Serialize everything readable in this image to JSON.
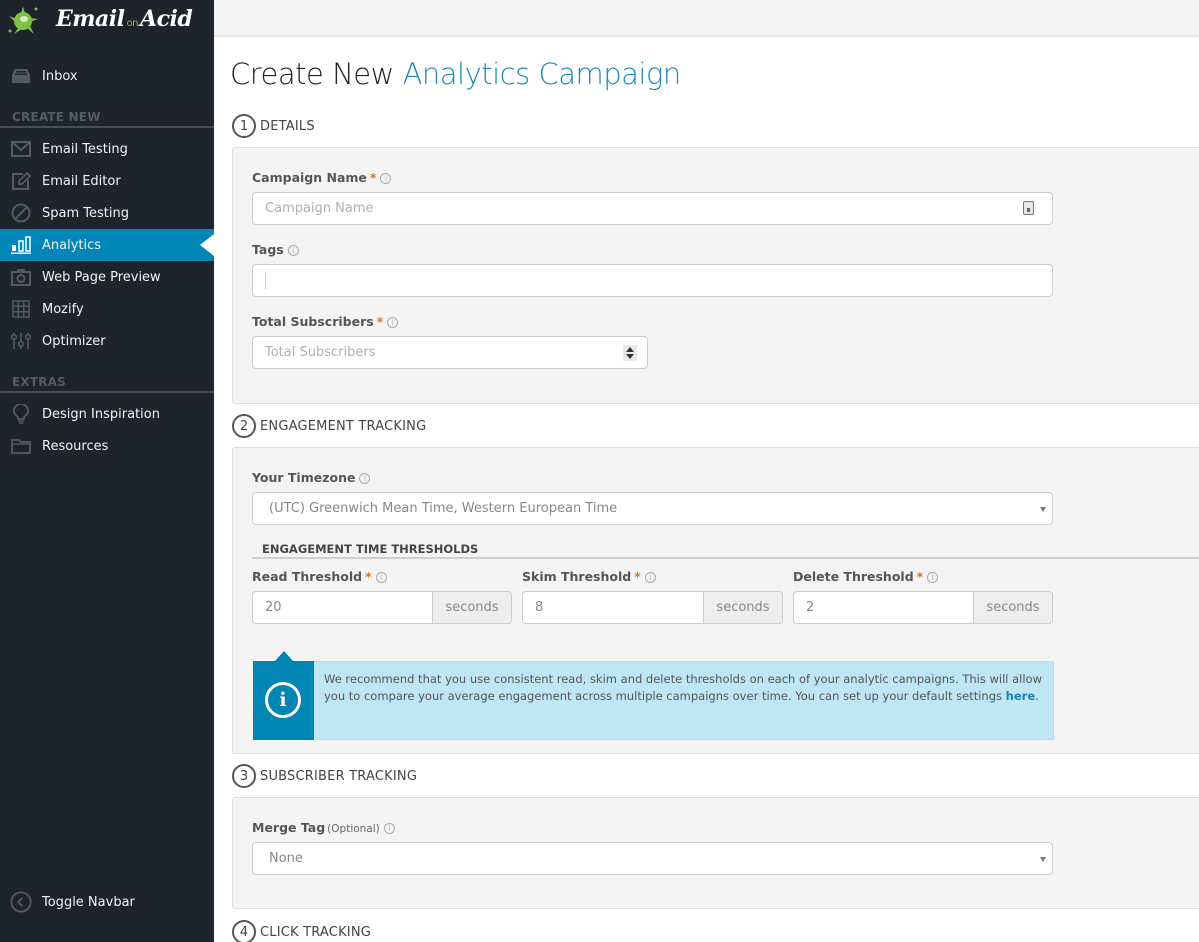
{
  "brand": {
    "name_part1": "Email",
    "name_part2": "on",
    "name_part3": "Acid",
    "accent_color": "#7dc242"
  },
  "sidebar": {
    "inbox": {
      "label": "Inbox",
      "icon": "inbox-tray-icon"
    },
    "create_new_heading": "CREATE NEW",
    "create_items": [
      {
        "label": "Email Testing",
        "icon": "envelope-icon",
        "active": false
      },
      {
        "label": "Email Editor",
        "icon": "edit-icon",
        "active": false
      },
      {
        "label": "Spam Testing",
        "icon": "ban-icon",
        "active": false
      },
      {
        "label": "Analytics",
        "icon": "bar-chart-icon",
        "active": true
      },
      {
        "label": "Web Page Preview",
        "icon": "camera-icon",
        "active": false
      },
      {
        "label": "Mozify",
        "icon": "grid-icon",
        "active": false
      },
      {
        "label": "Optimizer",
        "icon": "sliders-icon",
        "active": false
      }
    ],
    "extras_heading": "EXTRAS",
    "extras_items": [
      {
        "label": "Design Inspiration",
        "icon": "lightbulb-icon"
      },
      {
        "label": "Resources",
        "icon": "folder-icon"
      }
    ],
    "toggle": {
      "label": "Toggle Navbar",
      "icon": "chevron-left-circle-icon"
    },
    "active_color": "#0087b7"
  },
  "page": {
    "title_plain": "Create New",
    "title_accent": "Analytics Campaign",
    "accent_color": "#1f88b8"
  },
  "sections": {
    "details": {
      "step": "1",
      "title": "DETAILS",
      "campaign_name": {
        "label": "Campaign Name",
        "required": "*",
        "placeholder": "Campaign Name",
        "value": ""
      },
      "tags": {
        "label": "Tags",
        "value": ""
      },
      "total_subscribers": {
        "label": "Total Subscribers",
        "required": "*",
        "placeholder": "Total Subscribers",
        "value": ""
      }
    },
    "engagement": {
      "step": "2",
      "title": "ENGAGEMENT TRACKING",
      "timezone": {
        "label": "Your Timezone",
        "selected": "(UTC) Greenwich Mean Time, Western European Time"
      },
      "thresholds_heading": "ENGAGEMENT TIME THRESHOLDS",
      "read": {
        "label": "Read Threshold",
        "required": "*",
        "value": "20",
        "unit": "seconds"
      },
      "skim": {
        "label": "Skim Threshold",
        "required": "*",
        "value": "8",
        "unit": "seconds"
      },
      "delete": {
        "label": "Delete Threshold",
        "required": "*",
        "value": "2",
        "unit": "seconds"
      },
      "notice": {
        "text": "We recommend that you use consistent read, skim and delete thresholds on each of your analytic campaigns. This will allow you to compare your average engagement across multiple campaigns over time. You can set up your default settings ",
        "link": "here",
        "after": "."
      }
    },
    "subscriber": {
      "step": "3",
      "title": "SUBSCRIBER TRACKING",
      "merge_tag": {
        "label": "Merge Tag",
        "optional": "(Optional)",
        "selected": "None"
      }
    },
    "click": {
      "step": "4",
      "title": "CLICK TRACKING"
    }
  },
  "info_glyph": "i"
}
